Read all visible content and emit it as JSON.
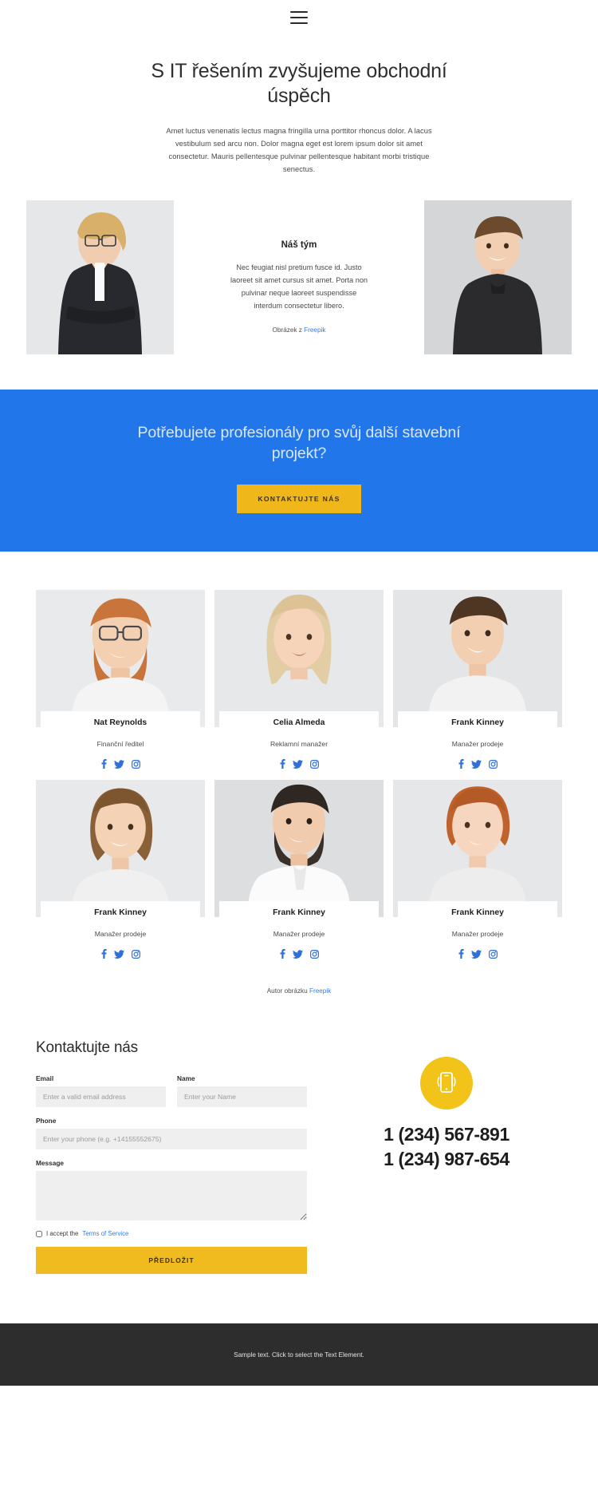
{
  "header": {
    "menu_icon": "hamburger-icon"
  },
  "hero": {
    "title": "S IT řešením zvyšujeme obchodní úspěch",
    "subtitle": "Amet luctus venenatis lectus magna fringilla urna porttitor rhoncus dolor. A lacus vestibulum sed arcu non. Dolor magna eget est lorem ipsum dolor sit amet consectetur. Mauris pellentesque pulvinar pellentesque habitant morbi tristique senectus."
  },
  "team_intro": {
    "heading": "Náš tým",
    "text": "Nec feugiat nisl pretium fusce id. Justo laoreet sit amet cursus sit amet. Porta non pulvinar neque laoreet suspendisse interdum consectetur libero.",
    "credit_prefix": "Obrázek z ",
    "credit_link": "Freepik",
    "left_photo_alt": "businesswoman-portrait",
    "right_photo_alt": "young-man-portrait"
  },
  "cta": {
    "heading": "Potřebujete profesionály pro svůj další stavební projekt?",
    "button": "KONTAKTUJTE NÁS",
    "bg_color": "#2176ea",
    "button_color": "#f0b71b"
  },
  "team": {
    "members": [
      {
        "name": "Nat Reynolds",
        "role": "Finanční ředitel"
      },
      {
        "name": "Celia Almeda",
        "role": "Reklamní manažer"
      },
      {
        "name": "Frank Kinney",
        "role": "Manažer prodeje"
      },
      {
        "name": "Frank Kinney",
        "role": "Manažer prodeje"
      },
      {
        "name": "Frank Kinney",
        "role": "Manažer prodeje"
      },
      {
        "name": "Frank Kinney",
        "role": "Manažer prodeje"
      }
    ],
    "social_icons": [
      "facebook-icon",
      "twitter-icon",
      "instagram-icon"
    ],
    "credit_prefix": "Autor obrázku ",
    "credit_link": "Freepik"
  },
  "contact": {
    "title": "Kontaktujte nás",
    "fields": {
      "email_label": "Email",
      "email_placeholder": "Enter a valid email address",
      "email_value": "",
      "name_label": "Name",
      "name_placeholder": "Enter your Name",
      "name_value": "",
      "phone_label": "Phone",
      "phone_placeholder": "Enter your phone (e.g. +14155552675)",
      "phone_value": "",
      "message_label": "Message",
      "message_placeholder": "",
      "message_value": ""
    },
    "terms_text": "I accept the ",
    "terms_link": "Terms of Service",
    "submit": "PŘEDLOŽIT",
    "phone_icon": "mobile-phone-icon",
    "phone_numbers": [
      "1 (234) 567-891",
      "1 (234) 987-654"
    ],
    "badge_color": "#f2c318"
  },
  "footer": {
    "text": "Sample text. Click to select the Text Element."
  }
}
